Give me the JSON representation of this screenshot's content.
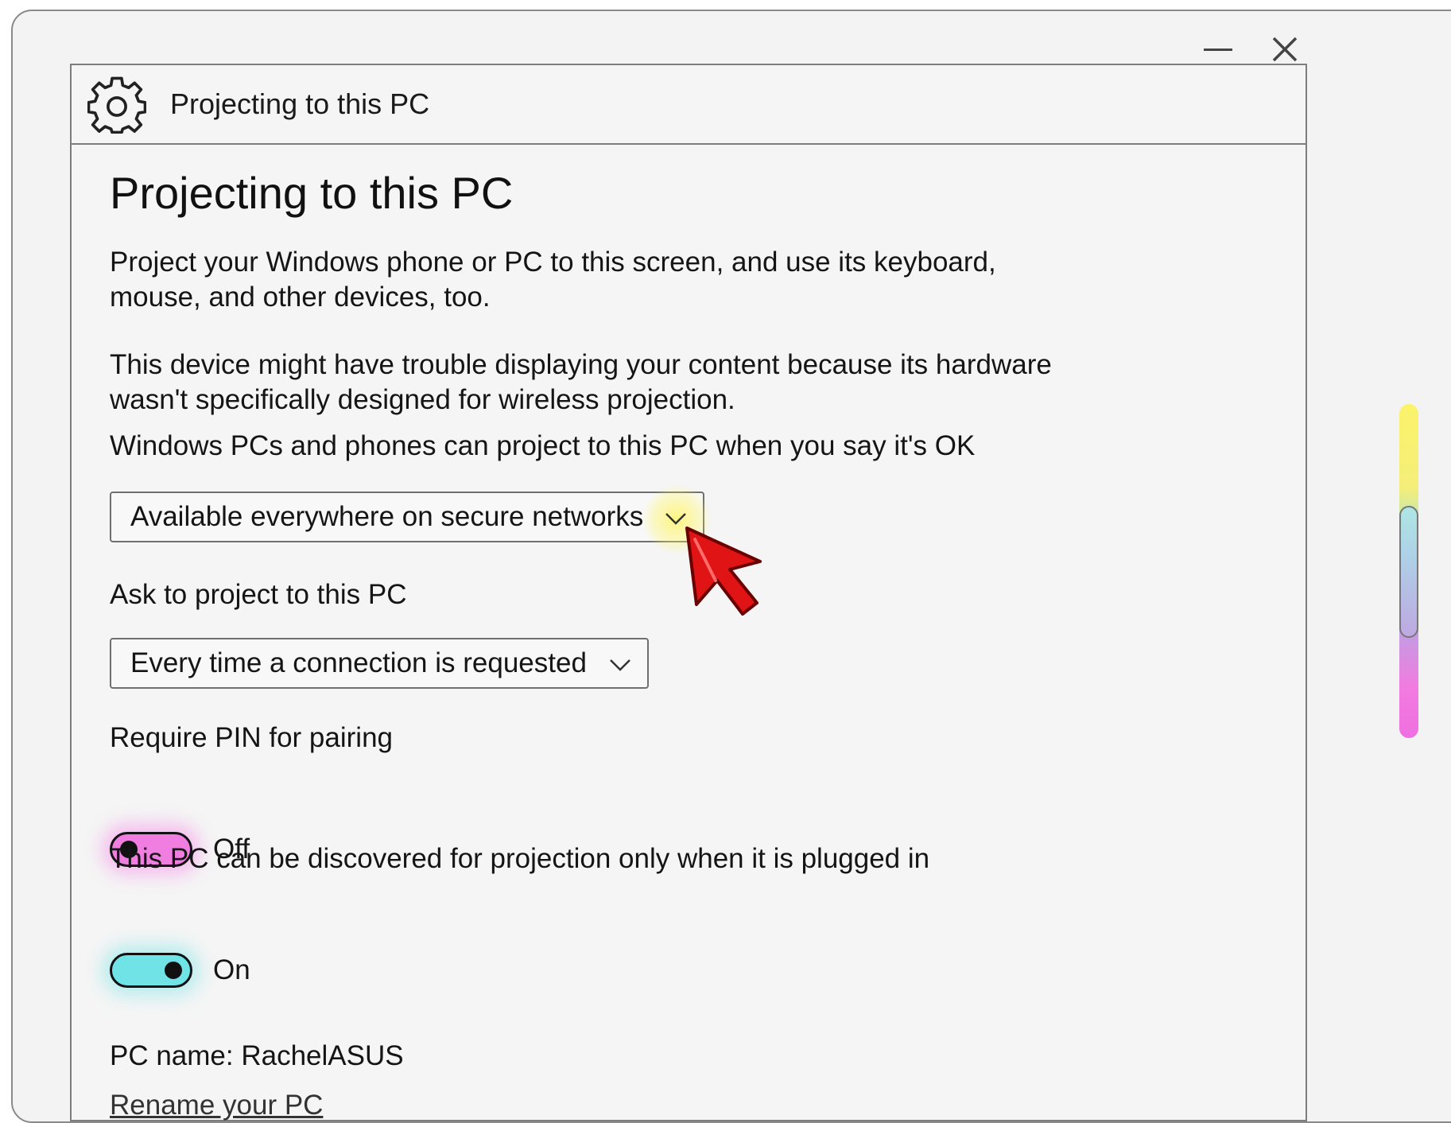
{
  "window": {
    "minimize_label": "—",
    "close_label": "✕"
  },
  "header": {
    "icon": "gear-icon",
    "title": "Projecting to this PC"
  },
  "page": {
    "title": "Projecting to this PC",
    "intro": "Project your Windows phone or PC to this screen, and use its keyboard, mouse, and other devices, too.",
    "warning": "This device might have trouble displaying your content because its hardware wasn't specifically designed for wireless projection.",
    "availability_label": "Windows PCs and phones can project to this PC when you say it's OK",
    "availability_value": "Available everywhere on secure networks",
    "ask_label": "Ask to project to this PC",
    "ask_value": "Every time a connection is requested",
    "pin_label": "Require PIN for pairing",
    "pin_state": "Off",
    "discover_label": "This PC can be discovered for projection only when it is plugged in",
    "discover_state": "On",
    "pc_name": "PC name: RachelASUS",
    "rename_link": "Rename your PC"
  },
  "colors": {
    "pin_toggle": "#f07de0",
    "discover_toggle": "#6fe3e6",
    "cursor": "#e01414",
    "dropdown_highlight": "#fbf36a"
  }
}
